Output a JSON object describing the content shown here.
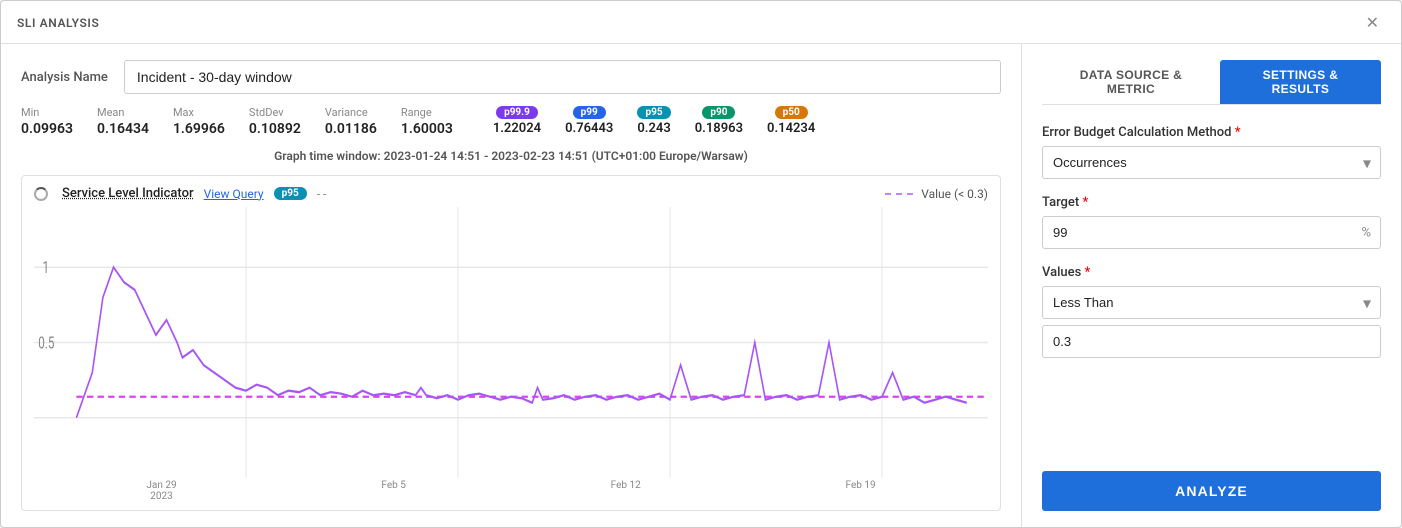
{
  "modal": {
    "title": "SLI ANALYSIS"
  },
  "analysis": {
    "name_label": "Analysis Name",
    "name_value": "Incident - 30-day window"
  },
  "stats": {
    "min_label": "Min",
    "min_value": "0.09963",
    "mean_label": "Mean",
    "mean_value": "0.16434",
    "max_label": "Max",
    "max_value": "1.69966",
    "stddev_label": "StdDev",
    "stddev_value": "0.10892",
    "variance_label": "Variance",
    "variance_value": "0.01186",
    "range_label": "Range",
    "range_value": "1.60003"
  },
  "percentiles": [
    {
      "label": "p99.9",
      "value": "1.22024",
      "class": "badge-p999"
    },
    {
      "label": "p99",
      "value": "0.76443",
      "class": "badge-p99"
    },
    {
      "label": "p95",
      "value": "0.243",
      "class": "badge-p95"
    },
    {
      "label": "p90",
      "value": "0.18963",
      "class": "badge-p90"
    },
    {
      "label": "p50",
      "value": "0.14234",
      "class": "badge-p50"
    }
  ],
  "time_window": {
    "label": "Graph time window:",
    "value": "2023-01-24 14:51 - 2023-02-23 14:51 (UTC+01:00 Europe/Warsaw)"
  },
  "chart": {
    "sli_label": "Service Level Indicator",
    "view_query": "View Query",
    "p95_badge": "p95",
    "p95_value": "- -",
    "value_legend": "Value (< 0.3)",
    "y_labels": [
      "1",
      "0.5"
    ],
    "x_labels": [
      "Jan 29\n2023",
      "Feb 5",
      "Feb 12",
      "Feb 19"
    ]
  },
  "right_panel": {
    "tab_data_source": "DATA SOURCE & METRIC",
    "tab_settings": "SETTINGS & RESULTS",
    "error_budget_label": "Error Budget Calculation Method",
    "error_budget_value": "Occurrences",
    "target_label": "Target",
    "target_value": "99",
    "target_suffix": "%",
    "values_label": "Values",
    "values_value": "Less Than",
    "threshold_value": "0.3",
    "analyze_btn": "ANALYZE"
  }
}
